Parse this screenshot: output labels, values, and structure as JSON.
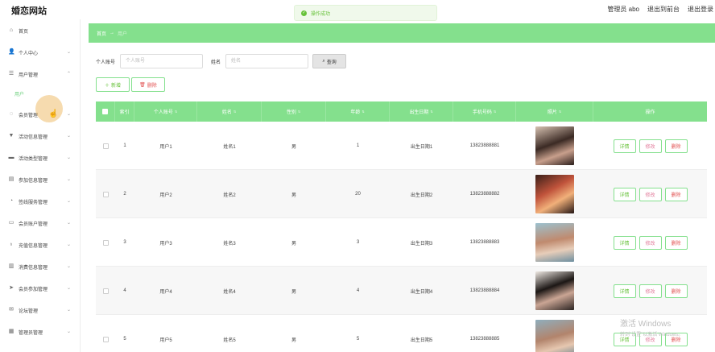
{
  "header": {
    "site_title": "婚恋网站",
    "admin_label": "管理员 abo",
    "exit_front": "退出到前台",
    "logout": "退出登录"
  },
  "toast": {
    "message": "操作成功"
  },
  "sidebar": {
    "items": [
      {
        "label": "首页",
        "icon": "home-icon"
      },
      {
        "label": "个人中心",
        "icon": "user-icon"
      },
      {
        "label": "用户管理",
        "icon": "users-icon",
        "sub": [
          "用户"
        ]
      },
      {
        "label": "会员管理",
        "icon": "member-icon"
      },
      {
        "label": "活动信息管理",
        "icon": "activity-icon"
      },
      {
        "label": "活动类型管理",
        "icon": "type-icon"
      },
      {
        "label": "参加信息管理",
        "icon": "join-icon"
      },
      {
        "label": "签线服务管理",
        "icon": "service-icon"
      },
      {
        "label": "会员账户管理",
        "icon": "account-icon"
      },
      {
        "label": "充值信息管理",
        "icon": "recharge-icon"
      },
      {
        "label": "消费信息管理",
        "icon": "consume-icon"
      },
      {
        "label": "会员参加管理",
        "icon": "send-icon"
      },
      {
        "label": "论坛管理",
        "icon": "forum-icon"
      },
      {
        "label": "管理员管理",
        "icon": "admin-icon"
      }
    ]
  },
  "breadcrumb": {
    "home": "首页",
    "separator": "→",
    "current": "用户"
  },
  "search": {
    "account_label": "个人账号",
    "account_placeholder": "个人账号",
    "name_label": "姓名",
    "name_placeholder": "姓名",
    "query_button": "查询"
  },
  "actions": {
    "add": "新增",
    "delete": "删除"
  },
  "table": {
    "columns": [
      "索引",
      "个人账号",
      "姓名",
      "性别",
      "年龄",
      "出生日期",
      "手机号码",
      "照片",
      "操作"
    ],
    "rows": [
      {
        "index": "1",
        "account": "用户1",
        "name": "姓名1",
        "gender": "男",
        "age": "1",
        "birth": "出生日期1",
        "phone": "13823888881"
      },
      {
        "index": "2",
        "account": "用户2",
        "name": "姓名2",
        "gender": "男",
        "age": "20",
        "birth": "出生日期2",
        "phone": "13823888882"
      },
      {
        "index": "3",
        "account": "用户3",
        "name": "姓名3",
        "gender": "男",
        "age": "3",
        "birth": "出生日期3",
        "phone": "13823888883"
      },
      {
        "index": "4",
        "account": "用户4",
        "name": "姓名4",
        "gender": "男",
        "age": "4",
        "birth": "出生日期4",
        "phone": "13823888884"
      },
      {
        "index": "5",
        "account": "用户5",
        "name": "姓名5",
        "gender": "男",
        "age": "5",
        "birth": "出生日期5",
        "phone": "13823888885"
      }
    ],
    "ops": {
      "detail": "详情",
      "edit": "修改",
      "delete": "删除"
    }
  },
  "watermark": {
    "line1": "激活 Windows",
    "line2": "转到\"设置\"以激活 Windows。"
  },
  "colors": {
    "accent": "#84e08d",
    "success": "#67c23a",
    "danger": "#e25353"
  }
}
